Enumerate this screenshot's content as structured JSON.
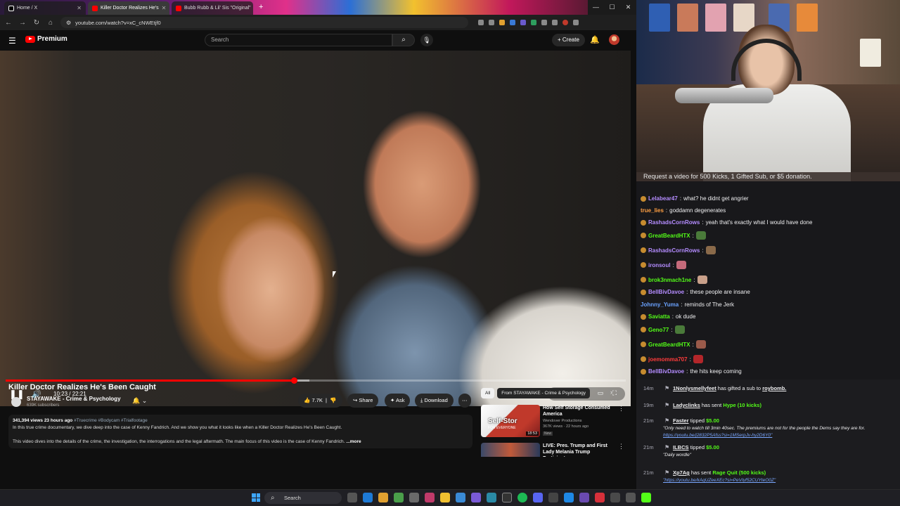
{
  "browser": {
    "tabs": [
      {
        "label": "Home / X"
      },
      {
        "label": "Killer Doctor Realizes He's"
      },
      {
        "label": "Bubb Rubb & Lil' Sis \"Original\""
      }
    ],
    "url": "youtube.com/watch?v=xC_cNWEtjf0"
  },
  "youtube": {
    "brand": "Premium",
    "search_placeholder": "Search",
    "create_label": "Create",
    "video": {
      "time": "10:23 / 22:21",
      "progress": 0.465,
      "title": "Killer Doctor Realizes He's Been Caught",
      "channel": "STAYAWAKE - Crime & Psychology",
      "subscribers": "639K subscribers",
      "likes": "7.7K",
      "share": "Share",
      "ask": "Ask",
      "download": "Download",
      "desc_meta": "341,394 views  23 hours ago",
      "desc_tags": "#Truecrime #Bodycam #Trialfootage",
      "desc_line1": "In this true crime documentary, we dive deep into the case of Kenny Fandrich. And we show you what it looks like when a Killer Doctor Realizes He's Been Caught.",
      "desc_line2": "This video dives into the details of the crime, the investigation, the interrogations and the legal aftermath. The main focus of this video is the case of Kenny Fandrich.",
      "more": "...more"
    },
    "chips": [
      "All",
      "From STAYAWAKE - Crime & Psychology"
    ],
    "recommendations": [
      {
        "title": "How Self Storage Consumed America",
        "channel": "Wendover Productions",
        "views": "367K views · 22 hours ago",
        "badge": "New",
        "duration": "18:53",
        "thumb_text": "Self-Stor",
        "thumb_text2": "FOR EVERYONE"
      },
      {
        "title": "LIVE: Pres. Trump and First Lady Melania Trump Participat...",
        "channel": "",
        "views": "",
        "badge": "",
        "duration": ""
      }
    ]
  },
  "stream": {
    "banner": "Request a video for 500 Kicks, 1 Gifted Sub, or $5 donation."
  },
  "chat": [
    {
      "user": "Lelabear47",
      "text": "what? he didnt get angrier",
      "color": "#b48cff",
      "badge": true
    },
    {
      "user": "true_lies",
      "text": "goddamn degenerates",
      "color": "#ff9f43",
      "badge": false
    },
    {
      "user": "RashadsCornRows",
      "text": "yeah that's exactly what I would have done",
      "color": "#b48cff",
      "badge": true
    },
    {
      "user": "GreatBeardHTX",
      "text": "",
      "color": "#53fc18",
      "badge": true,
      "emote": "#4a7a3a"
    },
    {
      "user": "RashadsCornRows",
      "text": "",
      "color": "#b48cff",
      "badge": true,
      "emote": "#8a6a4a"
    },
    {
      "user": "ironsoul",
      "text": "",
      "color": "#b48cff",
      "badge": true,
      "emote": "#c46a7a"
    },
    {
      "user": "brok3nmach1ne",
      "text": "",
      "color": "#53fc18",
      "badge": true,
      "emote": "#c9a08a"
    },
    {
      "user": "BellBivDavoe",
      "text": "these people are insane",
      "color": "#b48cff",
      "badge": true
    },
    {
      "user": "Johnny_Yuma",
      "text": "reminds of The Jerk",
      "color": "#6aa2ff",
      "badge": false
    },
    {
      "user": "Saviatta",
      "text": "ok dude",
      "color": "#53fc18",
      "badge": true
    },
    {
      "user": "Geno77",
      "text": "",
      "color": "#53fc18",
      "badge": true,
      "emote": "#4a7a3a"
    },
    {
      "user": "GreatBeardHTX",
      "text": "",
      "color": "#53fc18",
      "badge": true,
      "emote": "#9a5a4a"
    },
    {
      "user": "joemomma707",
      "text": "",
      "color": "#ff3b3b",
      "badge": true,
      "emote": "#b3262a"
    },
    {
      "user": "BellBivDavoe",
      "text": "the hits keep coming",
      "color": "#b48cff",
      "badge": true
    }
  ],
  "events": [
    {
      "age": "14m",
      "user": "1Nonlysmellyfeet",
      "action": "has gifted a sub to",
      "target": "roybomb."
    },
    {
      "age": "19m",
      "user": "Ladyclinks",
      "action": "has sent",
      "target": "Hype (10 kicks)"
    },
    {
      "age": "21m",
      "user": "Faster",
      "action": "tipped",
      "target": "$5.00",
      "note": "\"Only need to watch till 3min 40sec. The premiums are not for the people the Dems say they are for.",
      "link": "https://youtu.be/j2832P5Afss?si=1MSerpJv-hy2D6Y0\""
    },
    {
      "age": "21m",
      "user": "ILBCS",
      "action": "tipped",
      "target": "$5.00",
      "note": "\"Daily wordle\""
    },
    {
      "age": "21m",
      "user": "Xp7Ag",
      "action": "has sent",
      "target": "Rage Quit (500 kicks)",
      "link": "\"https://youtu.be/kAqUZeeXEc?si=PeVIyf52CUYteO0Z\""
    },
    {
      "age": "21m",
      "user": "Ladyclinks",
      "action": "has sent",
      "target": "Hype (10 kicks)"
    }
  ],
  "taskbar": {
    "search": "Search"
  },
  "colors": {
    "accent": "#ff0000",
    "kick_green": "#53fc18"
  }
}
